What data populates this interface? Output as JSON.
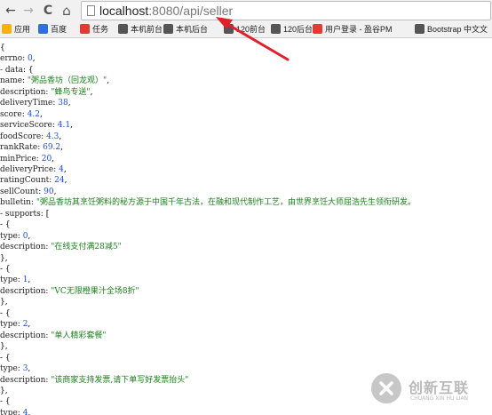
{
  "browser": {
    "url_host": "localhost",
    "url_path": ":8080/api/seller",
    "back_glyph": "←",
    "forward_glyph": "→",
    "reload_glyph": "C",
    "home_glyph": "⌂"
  },
  "bookmarks": [
    {
      "label": "应用",
      "color": "#f4b400"
    },
    {
      "label": "百度",
      "color": "#2f6fde"
    },
    {
      "label": "任务",
      "color": "#e53935"
    },
    {
      "label": "本机前台",
      "color": "#555555"
    },
    {
      "label": "本机后台",
      "color": "#555555"
    },
    {
      "label": "120前台",
      "color": "#555555"
    },
    {
      "label": "120后台",
      "color": "#555555"
    },
    {
      "label": "用户登录 - 盈谷PM",
      "color": "#e53935"
    },
    {
      "label": "Bootstrap 中文文",
      "color": "#555555"
    }
  ],
  "json": [
    {
      "text": "{"
    },
    {
      "text": "    errno: 0,"
    },
    {
      "text": "  - data: {"
    },
    {
      "text": "        name: \"粥品香坊（回龙观）\","
    },
    {
      "text": "        description: \"蜂鸟专送\","
    },
    {
      "text": "        deliveryTime: 38,"
    },
    {
      "text": "        score: 4.2,"
    },
    {
      "text": "        serviceScore: 4.1,"
    },
    {
      "text": "        foodScore: 4.3,"
    },
    {
      "text": "        rankRate: 69.2,"
    },
    {
      "text": "        minPrice: 20,"
    },
    {
      "text": "        deliveryPrice: 4,"
    },
    {
      "text": "        ratingCount: 24,"
    },
    {
      "text": "        sellCount: 90,"
    },
    {
      "text": "        bulletin: \"粥品香坊其烹饪粥料的秘方源于中国千年古法，在融和现代制作工艺，由世界烹饪大师屈浩先生领衔研发。"
    },
    {
      "text": "      - supports: ["
    },
    {
      "text": "          - {"
    },
    {
      "text": "                type: 0,"
    },
    {
      "text": "                description: \"在线支付满28减5\""
    },
    {
      "text": "            },"
    },
    {
      "text": "          - {"
    },
    {
      "text": "                type: 1,"
    },
    {
      "text": "                description: \"VC无限橙果汁全场8折\""
    },
    {
      "text": "            },"
    },
    {
      "text": "          - {"
    },
    {
      "text": "                type: 2,"
    },
    {
      "text": "                description: \"单人精彩套餐\""
    },
    {
      "text": "            },"
    },
    {
      "text": "          - {"
    },
    {
      "text": "                type: 3,"
    },
    {
      "text": "                description: \"该商家支持发票,请下单写好发票抬头\""
    },
    {
      "text": "            },"
    },
    {
      "text": "          - {"
    },
    {
      "text": "                type: 4,"
    }
  ],
  "watermark": {
    "cn": "创新互联",
    "en": "CHUANG XIN HU LIAN"
  },
  "colors": {
    "string": "#1a7f1a",
    "number": "#1a4fd6",
    "arrow": "#e0202a"
  }
}
